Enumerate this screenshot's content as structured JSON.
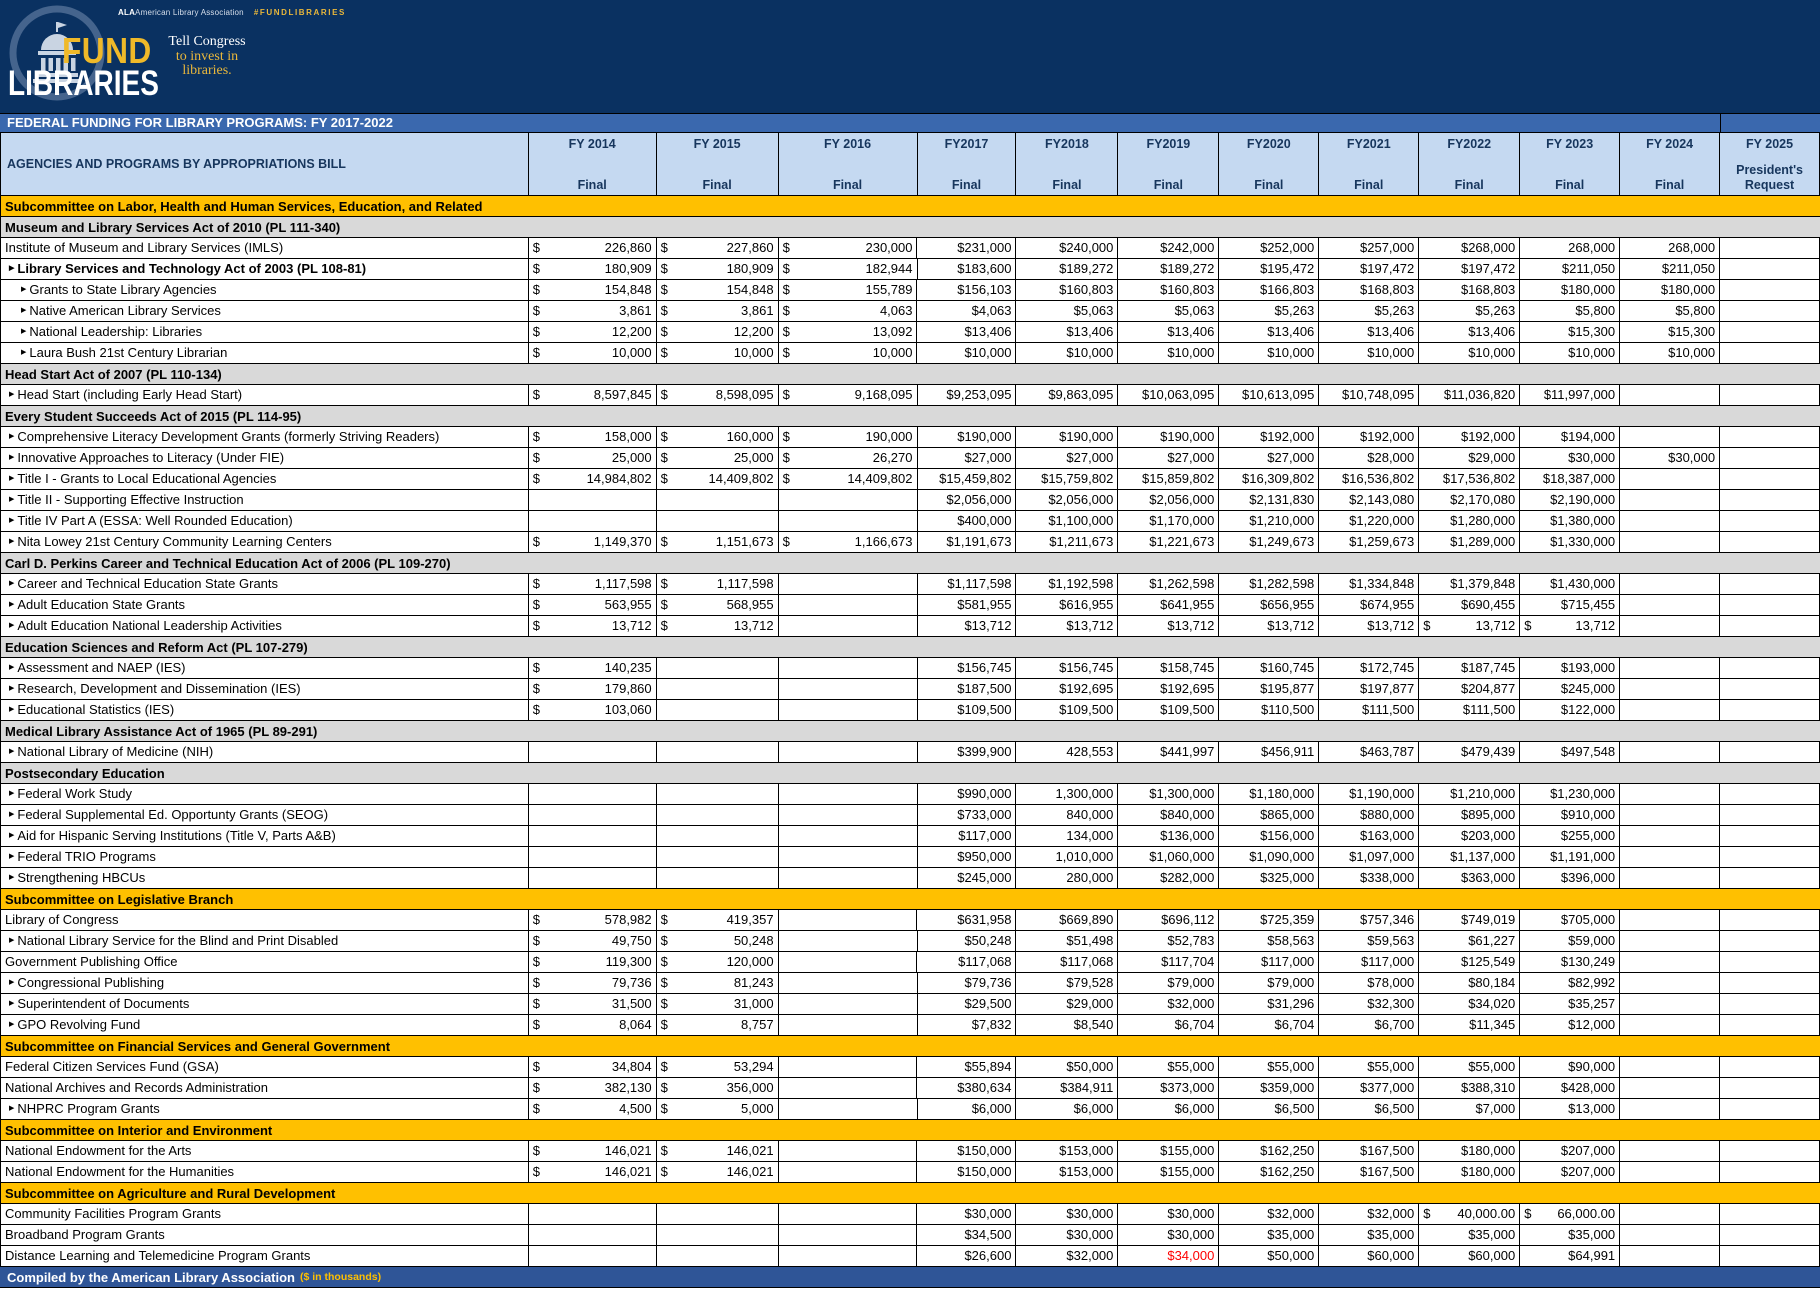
{
  "brand": {
    "ala": "ALA",
    "association": "American Library Association",
    "hashtag": "#FUNDLIBRARIES",
    "fund": "FUND",
    "libraries": "LIBRARIES",
    "tagline_line1": "Tell Congress",
    "tagline_line2": "to invest in libraries."
  },
  "title_bar": "FEDERAL FUNDING FOR LIBRARY PROGRAMS: FY 2017-2022",
  "footer": {
    "text": "Compiled by the American Library Association",
    "note": "($ in thousands)"
  },
  "colors": {
    "navy": "#0a3161",
    "title_blue": "#3a68ae",
    "header_blue": "#c5d9f1",
    "section_orange": "#ffc000",
    "section_gray": "#d9d9d9",
    "footer_blue": "#2f5597",
    "gold": "#efb929",
    "alert_red": "#ff0000"
  },
  "table": {
    "label_header": "AGENCIES AND PROGRAMS BY APPROPRIATIONS BILL",
    "columns": [
      {
        "key": "fy2014",
        "year": "FY 2014",
        "sub": "Final"
      },
      {
        "key": "fy2015",
        "year": "FY 2015",
        "sub": "Final"
      },
      {
        "key": "fy2016",
        "year": "FY 2016",
        "sub": "Final"
      },
      {
        "key": "fy2017",
        "year": "FY2017",
        "sub": "Final"
      },
      {
        "key": "fy2018",
        "year": "FY2018",
        "sub": "Final"
      },
      {
        "key": "fy2019",
        "year": "FY2019",
        "sub": "Final"
      },
      {
        "key": "fy2020",
        "year": "FY2020",
        "sub": "Final"
      },
      {
        "key": "fy2021",
        "year": "FY2021",
        "sub": "Final"
      },
      {
        "key": "fy2022",
        "year": "FY2022",
        "sub": "Final"
      },
      {
        "key": "fy2023",
        "year": "FY 2023",
        "sub": "Final"
      },
      {
        "key": "fy2024",
        "year": "FY 2024",
        "sub": "Final"
      },
      {
        "key": "fy2025",
        "year": "FY 2025",
        "sub": "President's Request"
      }
    ],
    "rows": [
      {
        "t": "o",
        "n": "Subcommittee on Labor, Health and Human Services, Education, and Related"
      },
      {
        "t": "g",
        "n": "Museum and Library Services Act of 2010 (PL 111-340)"
      },
      {
        "t": "d",
        "l": 0,
        "n": "Institute of Museum and Library Services (IMLS)",
        "c": [
          "a:226,860",
          "a:227,860",
          "a:230,000",
          "$231,000",
          "$240,000",
          "$242,000",
          "$252,000",
          "$257,000",
          "$268,000",
          "268,000",
          "268,000",
          ""
        ]
      },
      {
        "t": "d",
        "l": 1,
        "b": 1,
        "n": "Library Services and Technology Act of 2003 (PL 108-81)",
        "c": [
          "a:180,909",
          "a:180,909",
          "a:182,944",
          "$183,600",
          "$189,272",
          "$189,272",
          "$195,472",
          "$197,472",
          "$197,472",
          "$211,050",
          "$211,050",
          ""
        ]
      },
      {
        "t": "d",
        "l": 2,
        "n": "Grants to State Library Agencies",
        "c": [
          "a:154,848",
          "a:154,848",
          "a:155,789",
          "$156,103",
          "$160,803",
          "$160,803",
          "$166,803",
          "$168,803",
          "$168,803",
          "$180,000",
          "$180,000",
          ""
        ]
      },
      {
        "t": "d",
        "l": 2,
        "n": "Native American Library Services",
        "c": [
          "a:3,861",
          "a:3,861",
          "a:4,063",
          "$4,063",
          "$5,063",
          "$5,063",
          "$5,263",
          "$5,263",
          "$5,263",
          "$5,800",
          "$5,800",
          ""
        ]
      },
      {
        "t": "d",
        "l": 2,
        "n": "National Leadership: Libraries",
        "c": [
          "a:12,200",
          "a:12,200",
          "a:13,092",
          "$13,406",
          "$13,406",
          "$13,406",
          "$13,406",
          "$13,406",
          "$13,406",
          "$15,300",
          "$15,300",
          ""
        ]
      },
      {
        "t": "d",
        "l": 2,
        "n": "Laura Bush 21st Century Librarian",
        "c": [
          "a:10,000",
          "a:10,000",
          "a:10,000",
          "$10,000",
          "$10,000",
          "$10,000",
          "$10,000",
          "$10,000",
          "$10,000",
          "$10,000",
          "$10,000",
          ""
        ]
      },
      {
        "t": "g",
        "n": "Head Start Act of 2007 (PL 110-134)"
      },
      {
        "t": "d",
        "l": 1,
        "n": "Head Start (including Early Head Start)",
        "c": [
          "a:8,597,845",
          "a:8,598,095",
          "a:9,168,095",
          "$9,253,095",
          "$9,863,095",
          "$10,063,095",
          "$10,613,095",
          "$10,748,095",
          "$11,036,820",
          "$11,997,000",
          "",
          ""
        ]
      },
      {
        "t": "g",
        "n": "Every Student Succeeds Act of 2015 (PL  114-95)"
      },
      {
        "t": "d",
        "l": 1,
        "n": "Comprehensive Literacy Development Grants (formerly Striving Readers)",
        "c": [
          "a:158,000",
          "a:160,000",
          "a:190,000",
          "$190,000",
          "$190,000",
          "$190,000",
          "$192,000",
          "$192,000",
          "$192,000",
          "$194,000",
          "",
          ""
        ]
      },
      {
        "t": "d",
        "l": 1,
        "n": "Innovative Approaches to Literacy (Under FIE)",
        "c": [
          "a:25,000",
          "a:25,000",
          "a:26,270",
          "$27,000",
          "$27,000",
          "$27,000",
          "$27,000",
          "$28,000",
          "$29,000",
          "$30,000",
          "$30,000",
          ""
        ]
      },
      {
        "t": "d",
        "l": 1,
        "n": "Title I - Grants to Local Educational Agencies",
        "c": [
          "a:14,984,802",
          "a:14,409,802",
          "a:14,409,802",
          "$15,459,802",
          "$15,759,802",
          "$15,859,802",
          "$16,309,802",
          "$16,536,802",
          "$17,536,802",
          "$18,387,000",
          "",
          ""
        ]
      },
      {
        "t": "d",
        "l": 1,
        "n": "Title II - Supporting Effective Instruction",
        "c": [
          "",
          "",
          "",
          "$2,056,000",
          "$2,056,000",
          "$2,056,000",
          "$2,131,830",
          "$2,143,080",
          "$2,170,080",
          "$2,190,000",
          "",
          ""
        ]
      },
      {
        "t": "d",
        "l": 1,
        "n": "Title IV Part A (ESSA: Well Rounded Education)",
        "c": [
          "",
          "",
          "",
          "$400,000",
          "$1,100,000",
          "$1,170,000",
          "$1,210,000",
          "$1,220,000",
          "$1,280,000",
          "$1,380,000",
          "",
          ""
        ]
      },
      {
        "t": "d",
        "l": 1,
        "n": "Nita Lowey 21st Century Community Learning Centers",
        "c": [
          "a:1,149,370",
          "a:1,151,673",
          "a:1,166,673",
          "$1,191,673",
          "$1,211,673",
          "$1,221,673",
          "$1,249,673",
          "$1,259,673",
          "$1,289,000",
          "$1,330,000",
          "",
          ""
        ]
      },
      {
        "t": "g",
        "n": "Carl D. Perkins Career and Technical Education Act of 2006 (PL 109-270)"
      },
      {
        "t": "d",
        "l": 1,
        "n": "Career and Technical Education State Grants",
        "c": [
          "a:1,117,598",
          "a:1,117,598",
          "",
          "$1,117,598",
          "$1,192,598",
          "$1,262,598",
          "$1,282,598",
          "$1,334,848",
          "$1,379,848",
          "$1,430,000",
          "",
          ""
        ]
      },
      {
        "t": "d",
        "l": 1,
        "n": "Adult Education State Grants",
        "c": [
          "a:563,955",
          "a:568,955",
          "",
          "$581,955",
          "$616,955",
          "$641,955",
          "$656,955",
          "$674,955",
          "$690,455",
          "$715,455",
          "",
          ""
        ]
      },
      {
        "t": "d",
        "l": 1,
        "n": "Adult Education National Leadership Activities",
        "c": [
          "a:13,712",
          "a:13,712",
          "",
          "$13,712",
          "$13,712",
          "$13,712",
          "$13,712",
          "$13,712",
          "a:13,712",
          "a:13,712",
          "",
          ""
        ]
      },
      {
        "t": "g",
        "n": "Education Sciences and Reform Act (PL 107-279)"
      },
      {
        "t": "d",
        "l": 1,
        "n": "Assessment and NAEP (IES)",
        "c": [
          "a:140,235",
          "",
          "",
          "$156,745",
          "$156,745",
          "$158,745",
          "$160,745",
          "$172,745",
          "$187,745",
          "$193,000",
          "",
          ""
        ]
      },
      {
        "t": "d",
        "l": 1,
        "n": "Research, Development and Dissemination (IES)",
        "c": [
          "a:179,860",
          "",
          "",
          "$187,500",
          "$192,695",
          "$192,695",
          "$195,877",
          "$197,877",
          "$204,877",
          "$245,000",
          "",
          ""
        ]
      },
      {
        "t": "d",
        "l": 1,
        "n": "Educational Statistics (IES)",
        "c": [
          "a:103,060",
          "",
          "",
          "$109,500",
          "$109,500",
          "$109,500",
          "$110,500",
          "$111,500",
          "$111,500",
          "$122,000",
          "",
          ""
        ]
      },
      {
        "t": "g",
        "n": "Medical Library Assistance Act of 1965 (PL 89-291)"
      },
      {
        "t": "d",
        "l": 1,
        "n": "National Library of Medicine (NIH)",
        "c": [
          "",
          "",
          "",
          "$399,900",
          "428,553",
          "$441,997",
          "$456,911",
          "$463,787",
          "$479,439",
          "$497,548",
          "",
          ""
        ]
      },
      {
        "t": "g",
        "n": "Postsecondary Education"
      },
      {
        "t": "d",
        "l": 1,
        "n": "Federal Work Study",
        "c": [
          "",
          "",
          "",
          "$990,000",
          "1,300,000",
          "$1,300,000",
          "$1,180,000",
          "$1,190,000",
          "$1,210,000",
          "$1,230,000",
          "",
          ""
        ]
      },
      {
        "t": "d",
        "l": 1,
        "n": "Federal Supplemental Ed. Opportunty Grants (SEOG)",
        "c": [
          "",
          "",
          "",
          "$733,000",
          "840,000",
          "$840,000",
          "$865,000",
          "$880,000",
          "$895,000",
          "$910,000",
          "",
          ""
        ]
      },
      {
        "t": "d",
        "l": 1,
        "n": "Aid for Hispanic Serving Institutions (Title V, Parts A&B)",
        "c": [
          "",
          "",
          "",
          "$117,000",
          "134,000",
          "$136,000",
          "$156,000",
          "$163,000",
          "$203,000",
          "$255,000",
          "",
          ""
        ]
      },
      {
        "t": "d",
        "l": 1,
        "n": "Federal TRIO Programs",
        "c": [
          "",
          "",
          "",
          "$950,000",
          "1,010,000",
          "$1,060,000",
          "$1,090,000",
          "$1,097,000",
          "$1,137,000",
          "$1,191,000",
          "",
          ""
        ]
      },
      {
        "t": "d",
        "l": 1,
        "n": "Strengthening HBCUs",
        "c": [
          "",
          "",
          "",
          "$245,000",
          "280,000",
          "$282,000",
          "$325,000",
          "$338,000",
          "$363,000",
          "$396,000",
          "",
          ""
        ]
      },
      {
        "t": "o",
        "n": "Subcommittee on Legislative Branch"
      },
      {
        "t": "d",
        "l": 0,
        "n": "Library of Congress",
        "c": [
          "a:578,982",
          "a:419,357",
          "",
          "$631,958",
          "$669,890",
          "$696,112",
          "$725,359",
          "$757,346",
          "$749,019",
          "$705,000",
          "",
          ""
        ]
      },
      {
        "t": "d",
        "l": 1,
        "n": "National Library Service for the Blind and  Print Disabled",
        "c": [
          "a:49,750",
          "a:50,248",
          "",
          "$50,248",
          "$51,498",
          "$52,783",
          "$58,563",
          "$59,563",
          "$61,227",
          "$59,000",
          "",
          ""
        ]
      },
      {
        "t": "d",
        "l": 0,
        "n": "Government Publishing Office",
        "c": [
          "a:119,300",
          "a:120,000",
          "",
          "$117,068",
          "$117,068",
          "$117,704",
          "$117,000",
          "$117,000",
          "$125,549",
          "$130,249",
          "",
          ""
        ]
      },
      {
        "t": "d",
        "l": 1,
        "n": "Congressional Publishing",
        "c": [
          "a:79,736",
          "a:81,243",
          "",
          "$79,736",
          "$79,528",
          "$79,000",
          "$79,000",
          "$78,000",
          "$80,184",
          "$82,992",
          "",
          ""
        ]
      },
      {
        "t": "d",
        "l": 1,
        "n": "Superintendent of Documents",
        "c": [
          "a:31,500",
          "a:31,000",
          "",
          "$29,500",
          "$29,000",
          "$32,000",
          "$31,296",
          "$32,300",
          "$34,020",
          "$35,257",
          "",
          ""
        ]
      },
      {
        "t": "d",
        "l": 1,
        "n": "GPO Revolving Fund",
        "c": [
          "a:8,064",
          "a:8,757",
          "",
          "$7,832",
          "$8,540",
          "$6,704",
          "$6,704",
          "$6,700",
          "$11,345",
          "$12,000",
          "",
          ""
        ]
      },
      {
        "t": "o",
        "n": "Subcommittee on Financial Services and General Government"
      },
      {
        "t": "d",
        "l": 0,
        "n": "Federal Citizen Services Fund (GSA)",
        "c": [
          "a:34,804",
          "a:53,294",
          "",
          "$55,894",
          "$50,000",
          "$55,000",
          "$55,000",
          "$55,000",
          "$55,000",
          "$90,000",
          "",
          ""
        ]
      },
      {
        "t": "d",
        "l": 0,
        "n": "National Archives and Records Administration",
        "c": [
          "a:382,130",
          "a:356,000",
          "",
          "$380,634",
          "$384,911",
          "$373,000",
          "$359,000",
          "$377,000",
          "$388,310",
          "$428,000",
          "",
          ""
        ]
      },
      {
        "t": "d",
        "l": 1,
        "n": "NHPRC Program Grants",
        "c": [
          "a:4,500",
          "a:5,000",
          "",
          "$6,000",
          "$6,000",
          "$6,000",
          "$6,500",
          "$6,500",
          "$7,000",
          "$13,000",
          "",
          ""
        ]
      },
      {
        "t": "o",
        "n": "Subcommittee on Interior and Environment"
      },
      {
        "t": "d",
        "l": 0,
        "n": "National Endowment for the Arts",
        "c": [
          "a:146,021",
          "a:146,021",
          "",
          "$150,000",
          "$153,000",
          "$155,000",
          "$162,250",
          "$167,500",
          "$180,000",
          "$207,000",
          "",
          ""
        ]
      },
      {
        "t": "d",
        "l": 0,
        "n": "National Endowment for the Humanities",
        "c": [
          "a:146,021",
          "a:146,021",
          "",
          "$150,000",
          "$153,000",
          "$155,000",
          "$162,250",
          "$167,500",
          "$180,000",
          "$207,000",
          "",
          ""
        ]
      },
      {
        "t": "o",
        "n": "Subcommittee on Agriculture and Rural Development"
      },
      {
        "t": "d",
        "l": 0,
        "n": "Community Facilities Program Grants",
        "c": [
          "",
          "",
          "",
          "$30,000",
          "$30,000",
          "$30,000",
          "$32,000",
          "$32,000",
          "a:40,000.00",
          "a:66,000.00",
          "",
          ""
        ]
      },
      {
        "t": "d",
        "l": 0,
        "n": "Broadband Program Grants",
        "c": [
          "",
          "",
          "",
          "$34,500",
          "$30,000",
          "$30,000",
          "$35,000",
          "$35,000",
          "$35,000",
          "$35,000",
          "",
          ""
        ]
      },
      {
        "t": "d",
        "l": 0,
        "n": "Distance Learning and Telemedicine Program Grants",
        "c": [
          "",
          "",
          "",
          "$26,600",
          "$32,000",
          "r:$34,000",
          "$50,000",
          "$60,000",
          "$60,000",
          "$64,991",
          "",
          ""
        ]
      }
    ]
  }
}
